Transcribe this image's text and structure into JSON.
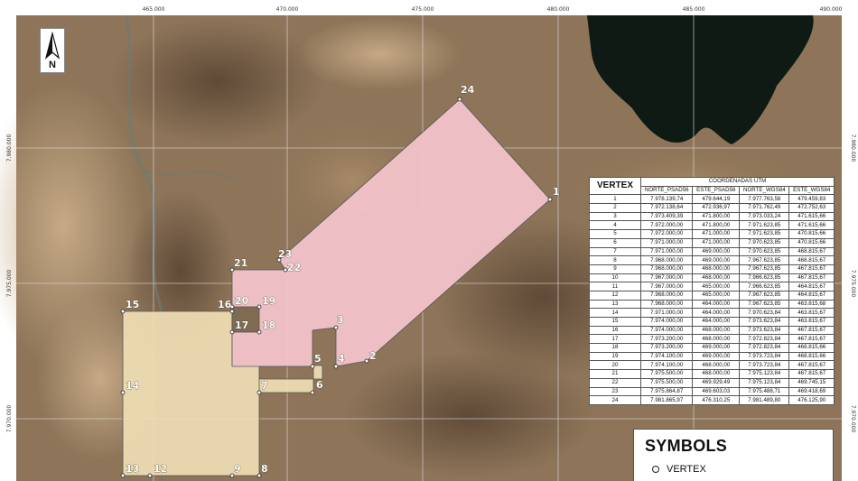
{
  "map": {
    "x_ticks": [
      "465.000",
      "470.000",
      "475.000",
      "480.000",
      "485.000",
      "490.000"
    ],
    "y_ticks": [
      "7.980.000",
      "7.975.000",
      "7.970.000"
    ],
    "north_label": "N",
    "vertex_labels": [
      "1",
      "2",
      "3",
      "4",
      "5",
      "6",
      "7",
      "8",
      "9",
      "12",
      "13",
      "14",
      "15",
      "16",
      "17",
      "18",
      "19",
      "20",
      "21",
      "22",
      "23",
      "24"
    ]
  },
  "table": {
    "vertex_header": "VERTEX",
    "group_header": "COORDENADAS UTM",
    "columns": [
      "NORTE_PSAD56",
      "ESTE_PSAD56",
      "NORTE_WGS84",
      "ESTE_WGS84"
    ],
    "rows": [
      [
        "1",
        "7.978.139,74",
        "479.644,19",
        "7.977.763,58",
        "479.459,83"
      ],
      [
        "2",
        "7.972.138,64",
        "472.936,97",
        "7.971.762,49",
        "472.752,63"
      ],
      [
        "3",
        "7.973.409,39",
        "471.800,00",
        "7.973.033,24",
        "471.615,66"
      ],
      [
        "4",
        "7.972.000,00",
        "471.800,00",
        "7.971.623,85",
        "471.615,66"
      ],
      [
        "5",
        "7.972.000,00",
        "471.000,00",
        "7.971.623,85",
        "470.815,66"
      ],
      [
        "6",
        "7.971.000,00",
        "471.000,00",
        "7.970.623,85",
        "470.815,66"
      ],
      [
        "7",
        "7.971.000,00",
        "469.000,00",
        "7.970.623,85",
        "468.815,67"
      ],
      [
        "8",
        "7.968.000,00",
        "469.000,00",
        "7.967.623,85",
        "468.815,67"
      ],
      [
        "9",
        "7.968.000,00",
        "468.000,00",
        "7.967.623,85",
        "467.815,67"
      ],
      [
        "10",
        "7.967.000,00",
        "468.000,00",
        "7.966.623,85",
        "467.815,67"
      ],
      [
        "11",
        "7.967.000,00",
        "465.000,00",
        "7.966.623,85",
        "464.815,67"
      ],
      [
        "12",
        "7.968.000,00",
        "465.000,00",
        "7.967.623,85",
        "464.815,67"
      ],
      [
        "13",
        "7.968.000,00",
        "464.000,00",
        "7.967.623,85",
        "463.815,68"
      ],
      [
        "14",
        "7.971.000,00",
        "464.000,00",
        "7.970.623,84",
        "463.815,67"
      ],
      [
        "15",
        "7.974.000,00",
        "464.000,00",
        "7.973.623,84",
        "463.815,67"
      ],
      [
        "16",
        "7.974.000,00",
        "468.000,00",
        "7.973.623,84",
        "467.815,67"
      ],
      [
        "17",
        "7.973.200,00",
        "468.000,00",
        "7.972.823,84",
        "467.815,67"
      ],
      [
        "18",
        "7.973.200,00",
        "469.000,00",
        "7.972.823,84",
        "468.815,66"
      ],
      [
        "19",
        "7.974.100,00",
        "469.000,00",
        "7.973.723,84",
        "468.815,66"
      ],
      [
        "20",
        "7.974.100,00",
        "468.000,00",
        "7.973.723,84",
        "467.815,67"
      ],
      [
        "21",
        "7.975.500,00",
        "468.000,00",
        "7.975.123,84",
        "467.815,67"
      ],
      [
        "22",
        "7.975.500,00",
        "469.929,49",
        "7.975.123,84",
        "469.745,15"
      ],
      [
        "23",
        "7.975.864,87",
        "469.603,03",
        "7.975.488,71",
        "469.418,69"
      ],
      [
        "24",
        "7.981.865,97",
        "476.310,25",
        "7.981.489,80",
        "476.125,90"
      ]
    ]
  },
  "symbols": {
    "title": "SYMBOLS",
    "vertex_label": "VERTEX"
  },
  "colors": {
    "pink_polygon": "#f4c4cb",
    "tan_polygon": "#efddb4",
    "terrain": "#8e7559",
    "lake": "#0f1a14"
  }
}
